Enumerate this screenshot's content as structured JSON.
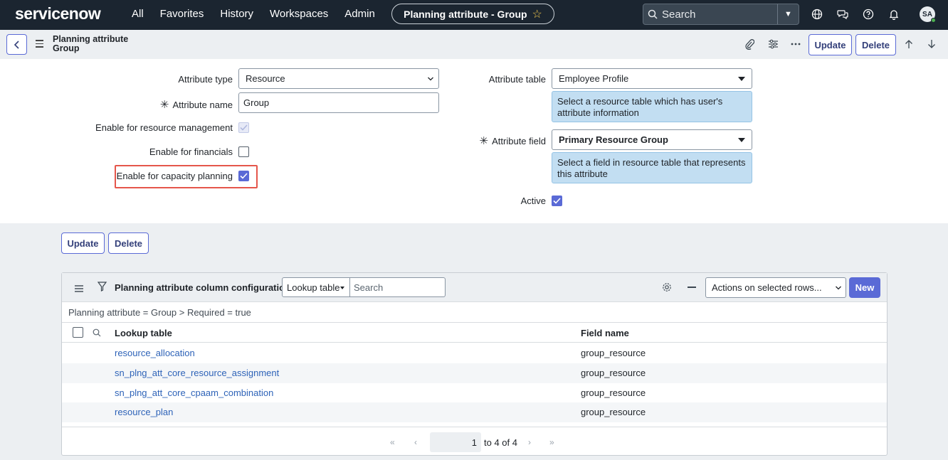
{
  "nav": {
    "logo": "servicenow",
    "items": [
      "All",
      "Favorites",
      "History",
      "Workspaces",
      "Admin"
    ],
    "page_title": "Planning attribute - Group",
    "search_placeholder": "Search",
    "avatar": "SA"
  },
  "header": {
    "title_line1": "Planning attribute",
    "title_line2": "Group",
    "update_label": "Update",
    "delete_label": "Delete"
  },
  "form": {
    "attribute_type_label": "Attribute type",
    "attribute_type_value": "Resource",
    "attribute_name_label": "Attribute name",
    "attribute_name_value": "Group",
    "resource_mgmt_label": "Enable for resource management",
    "financials_label": "Enable for financials",
    "capacity_label": "Enable for capacity planning",
    "attribute_table_label": "Attribute table",
    "attribute_table_value": "Employee Profile",
    "attribute_table_hint": "Select a resource table which has user's attribute information",
    "attribute_field_label": "Attribute field",
    "attribute_field_value": "Primary Resource Group",
    "attribute_field_hint": "Select a field in resource table that represents this attribute",
    "active_label": "Active",
    "required_mark": "✳",
    "resource_mgmt_checked": true,
    "financials_checked": false,
    "capacity_checked": true,
    "active_checked": true
  },
  "bottom_buttons": {
    "update_label": "Update",
    "delete_label": "Delete"
  },
  "related_list": {
    "title": "Planning attribute column configurations",
    "filter_field": "Lookup table",
    "search_placeholder": "Search",
    "actions_label": "Actions on selected rows...",
    "new_label": "New",
    "breadcrumb": "Planning attribute = Group  >  Required = true",
    "columns": [
      "Lookup table",
      "Field name"
    ],
    "rows": [
      {
        "lookup_table": "resource_allocation",
        "field_name": "group_resource"
      },
      {
        "lookup_table": "sn_plng_att_core_resource_assignment",
        "field_name": "group_resource"
      },
      {
        "lookup_table": "sn_plng_att_core_cpaam_combination",
        "field_name": "group_resource"
      },
      {
        "lookup_table": "resource_plan",
        "field_name": "group_resource"
      }
    ],
    "page_number": "1",
    "page_range": "to 4 of 4"
  },
  "colors": {
    "nav_bg": "#1b2530",
    "accent": "#5a6ad6",
    "highlight": "#e5564b",
    "hint_bg": "#c2def2",
    "link": "#2e63b8"
  }
}
